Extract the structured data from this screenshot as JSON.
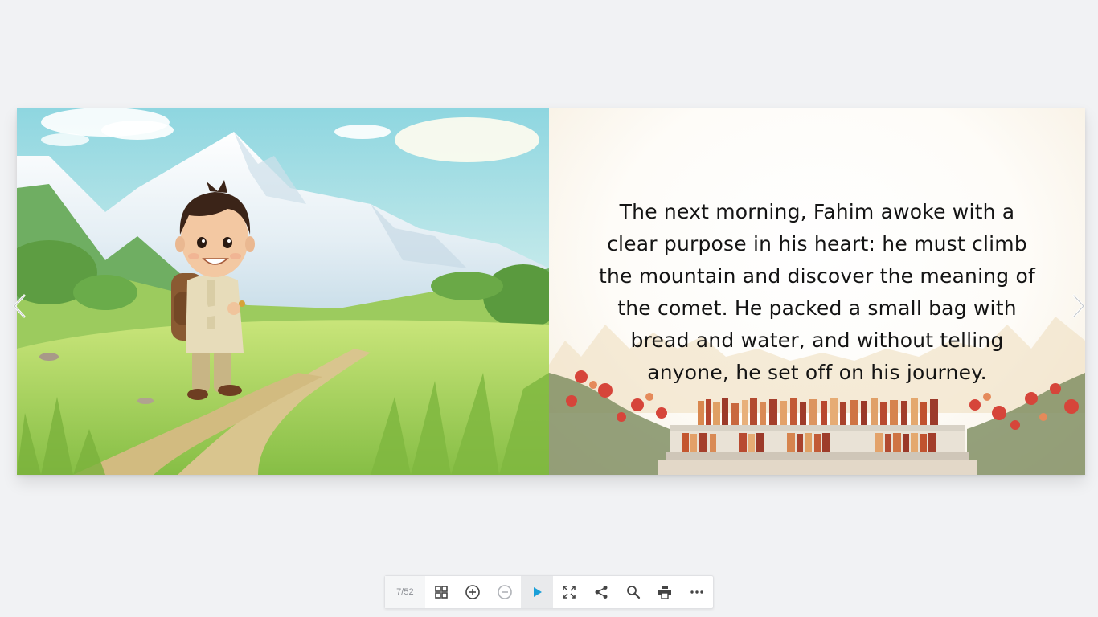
{
  "viewer": {
    "page_counter": "7/52",
    "prev_label": "‹",
    "next_label": "›"
  },
  "page_right": {
    "text": "The next morning, Fahim awoke with a clear purpose in his heart: he must climb the mountain and discover the meaning of the comet. He packed a small bag with bread and water, and without telling anyone, he set off on his journey."
  },
  "toolbar": {
    "buttons": [
      "grid-icon",
      "zoom-in-icon",
      "zoom-out-icon",
      "play-icon",
      "fullscreen-icon",
      "share-icon",
      "search-icon",
      "print-icon",
      "more-icon"
    ]
  },
  "colors": {
    "background": "#f1f2f4",
    "accent": "#1a9fd8",
    "icon": "#444444",
    "icon_disabled": "#b0b3b8"
  }
}
